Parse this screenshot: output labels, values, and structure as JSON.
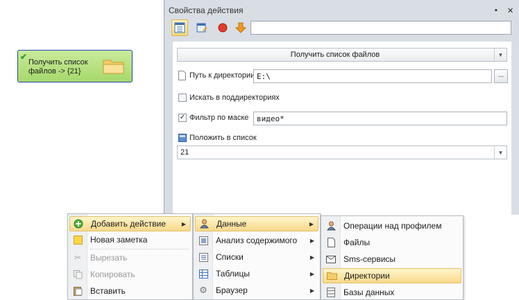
{
  "node": {
    "label_line1": "Получить список",
    "label_line2": "файлов -> {21}",
    "icon": "folder-icon",
    "status_icon": "check-icon"
  },
  "window": {
    "title": "Свойства действия",
    "pin_glyph": "▪",
    "close_glyph": "✕",
    "toolbar": [
      "properties-icon",
      "edit-icon",
      "record-icon",
      "arrow-down-icon"
    ],
    "name_value": ""
  },
  "properties": {
    "action_combo": "Получить список файлов",
    "dir_label": "Путь к директории",
    "dir_value": "E:\\",
    "browse_label": "...",
    "subdirs_label": "Искать в поддиректориях",
    "subdirs_checked": false,
    "mask_label": "Фильтр по маске",
    "mask_checked": true,
    "mask_value": "видео*",
    "list_label": "Положить в список",
    "list_value": "21"
  },
  "menu1": {
    "items": [
      {
        "label": "Добавить действие",
        "icon": "add-icon",
        "submenu": true,
        "highlighted": true,
        "disabled": false
      },
      {
        "label": "Новая заметка",
        "icon": "note-icon",
        "submenu": false,
        "highlighted": false,
        "disabled": false
      },
      {
        "label": "Вырезать",
        "icon": "cut-icon",
        "submenu": false,
        "highlighted": false,
        "disabled": true
      },
      {
        "label": "Копировать",
        "icon": "copy-icon",
        "submenu": false,
        "highlighted": false,
        "disabled": true
      },
      {
        "label": "Вставить",
        "icon": "paste-icon",
        "submenu": false,
        "highlighted": false,
        "disabled": false
      }
    ]
  },
  "menu2": {
    "items": [
      {
        "label": "Данные",
        "icon": "user-icon",
        "submenu": true,
        "highlighted": true
      },
      {
        "label": "Анализ содержимого",
        "icon": "analysis-icon",
        "submenu": true,
        "highlighted": false
      },
      {
        "label": "Списки",
        "icon": "list-icon",
        "submenu": true,
        "highlighted": false
      },
      {
        "label": "Таблицы",
        "icon": "table-icon",
        "submenu": true,
        "highlighted": false
      },
      {
        "label": "Браузер",
        "icon": "gear-icon",
        "submenu": true,
        "highlighted": false
      }
    ]
  },
  "menu3": {
    "items": [
      {
        "label": "Операции над профилем",
        "icon": "user-icon",
        "highlighted": false
      },
      {
        "label": "Файлы",
        "icon": "file-icon",
        "highlighted": false
      },
      {
        "label": "Sms-сервисы",
        "icon": "envelope-icon",
        "highlighted": false
      },
      {
        "label": "Директории",
        "icon": "folder-icon",
        "highlighted": true
      },
      {
        "label": "Базы данных",
        "icon": "database-icon",
        "highlighted": false
      }
    ]
  },
  "submenu_arrow": "▶",
  "combo_arrow": "▼"
}
